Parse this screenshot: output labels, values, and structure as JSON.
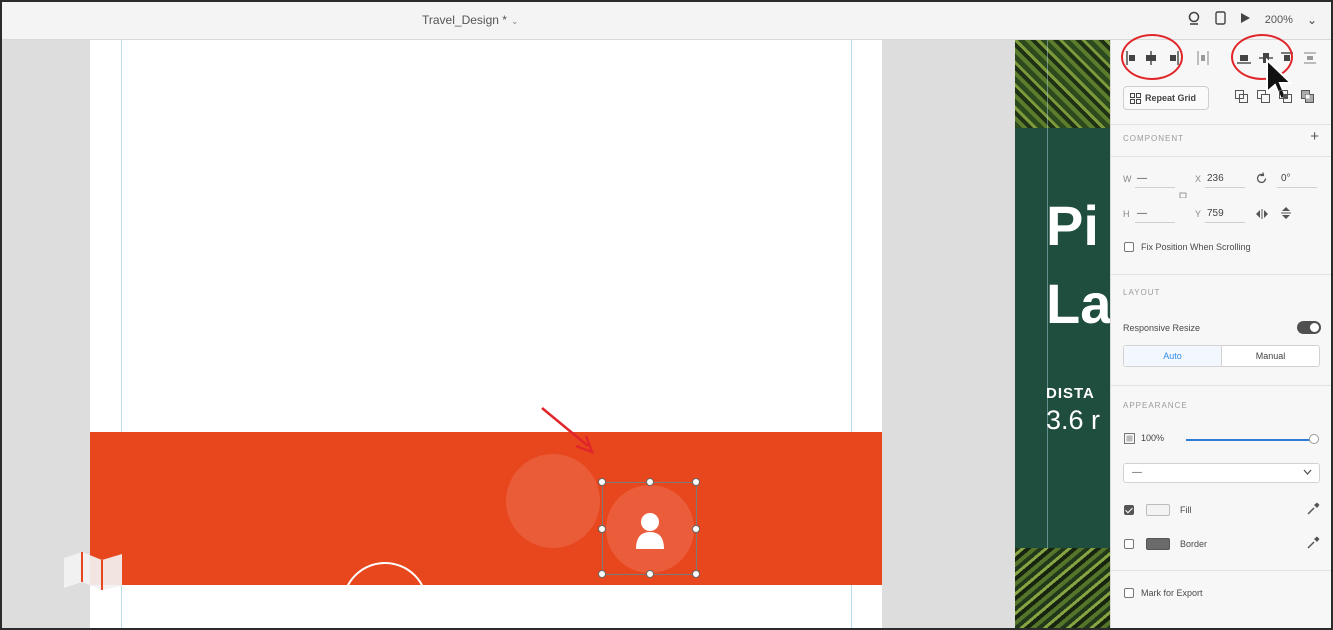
{
  "topbar": {
    "document_title": "Travel_Design *",
    "title_chevron": "⌄",
    "zoom": "200%",
    "zoom_chevron": "⌄"
  },
  "preview": {
    "heading_line1": "Pi",
    "heading_line2": "La",
    "distance_label": "DISTA",
    "distance_value": "3.6 r"
  },
  "inspector": {
    "repeat_grid_label": "Repeat Grid",
    "component_section": "COMPONENT",
    "component_add": "+",
    "w_label": "W",
    "w_value": "—",
    "x_label": "X",
    "x_value": "236",
    "h_label": "H",
    "h_value": "—",
    "y_label": "Y",
    "y_value": "759",
    "rotation_value": "0°",
    "fix_position_label": "Fix Position When Scrolling",
    "layout_section": "LAYOUT",
    "responsive_resize_label": "Responsive Resize",
    "responsive_resize_on": true,
    "resize_modes": [
      "Auto",
      "Manual"
    ],
    "appearance_section": "APPEARANCE",
    "opacity_value": "100%",
    "blend_value": "—",
    "fill_label": "Fill",
    "fill_checked": true,
    "border_label": "Border",
    "border_checked": false,
    "mark_for_export_label": "Mark for Export"
  },
  "colors": {
    "footer_band": "#e8461d",
    "preview_green": "#1f4d3e",
    "annotation_red": "#e0262a",
    "accent_blue": "#2d8ceb"
  }
}
